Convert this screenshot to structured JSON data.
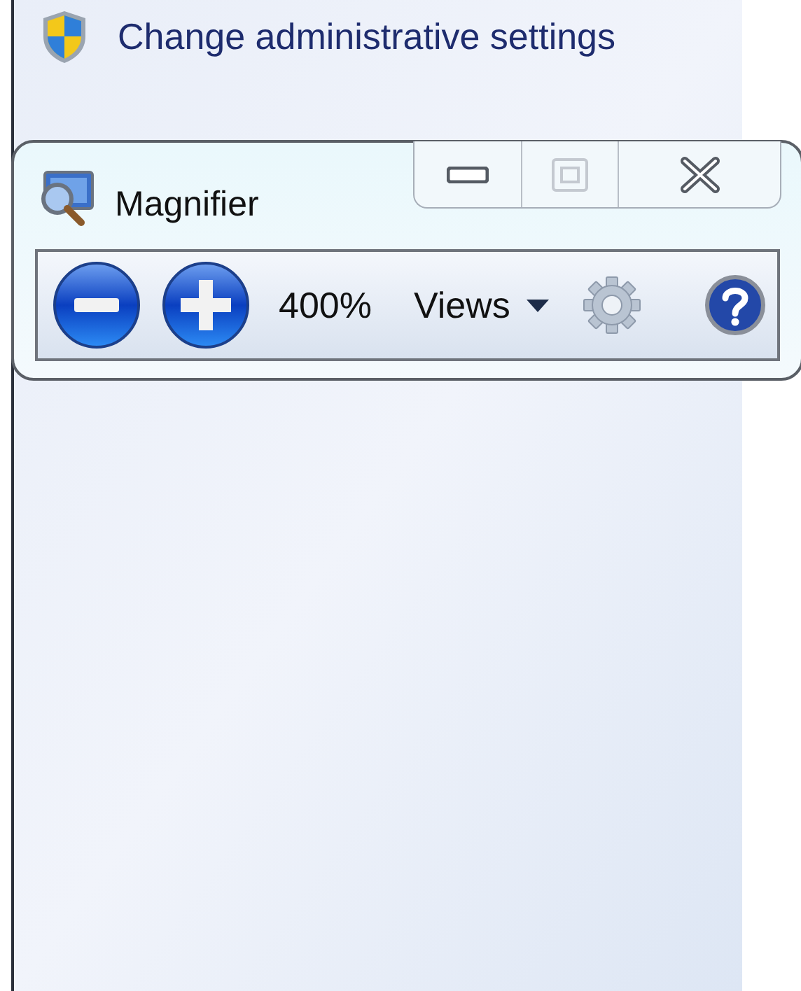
{
  "admin_link": {
    "label": "Change administrative settings"
  },
  "magnifier": {
    "title": "Magnifier",
    "caption_buttons": [
      {
        "kind": "minimize",
        "disabled": false
      },
      {
        "kind": "maximize",
        "disabled": true
      },
      {
        "kind": "close",
        "disabled": false
      }
    ],
    "toolbar": [
      {
        "kind": "zoom-out"
      },
      {
        "kind": "zoom-in"
      },
      {
        "kind": "zoom-level",
        "label": "400%"
      },
      {
        "kind": "views",
        "label": "Views"
      },
      {
        "kind": "options"
      },
      {
        "kind": "help"
      }
    ]
  }
}
